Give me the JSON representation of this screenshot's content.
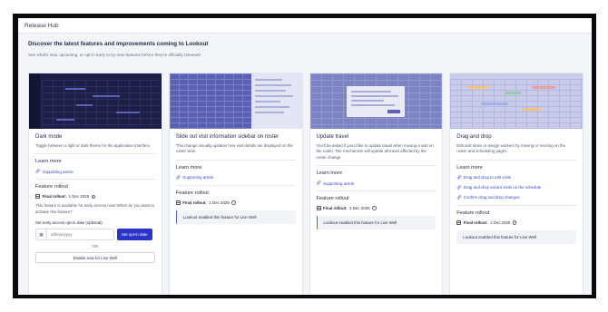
{
  "window": {
    "title": "Release Hub"
  },
  "intro": {
    "title": "Discover the latest features and improvements coming to Lookout",
    "subtitle": "See what's new, upcoming, or opt-in early to try new features before they're officially released."
  },
  "common": {
    "learn_more": "Learn more",
    "feature_rollout": "Feature rollout",
    "final_rollout_label": "Final rollout:",
    "final_rollout_date": "1 Dec 2025",
    "link_icon": "link-icon",
    "calendar_icon": "calendar-icon",
    "info_icon": "info-icon"
  },
  "cards": [
    {
      "title": "Dark mode",
      "description": "Toggle between a light or dark theme for the application interface.",
      "links": [
        "Supporting article"
      ],
      "availability": "This feature is available for early access now! When do you want to activate this feature?",
      "early_label": "Set early access opt-in date (optional)",
      "date_placeholder": "dd/mm/yyyy",
      "opt_in_button": "Set opt-in date",
      "or_text": "OR",
      "enable_now_button": "Enable now for Live Well"
    },
    {
      "title": "Slide out visit information sidebar on roster",
      "description": "This change visually updates how visit details are displayed on the roster view.",
      "links": [
        "Supporting article"
      ],
      "notice": "Lookout enabled this feature for Live Well"
    },
    {
      "title": "Update travel",
      "description": "You'll be asked if you'd like to update travel when moving a visit on the roster. The mechanism will update all travel affected by the roster change.",
      "links": [
        "Supporting article"
      ],
      "notice": "Lookout enabled this feature for Live Well"
    },
    {
      "title": "Drag and drop",
      "description": "Edit visit times or assign workers by moving or resizing on the roster and scheduling pages.",
      "links": [
        "Drag and drop to edit visits",
        "Drag and drop vacant visits on the schedule",
        "Confirm drag and drop changes"
      ],
      "notice": "Lookout enabled this feature for Live Well"
    }
  ],
  "colors": {
    "accent": "#2b34c8",
    "link": "#3d46c9",
    "frame": "#0b0b0f",
    "page_bg": "#f4f5f8"
  }
}
